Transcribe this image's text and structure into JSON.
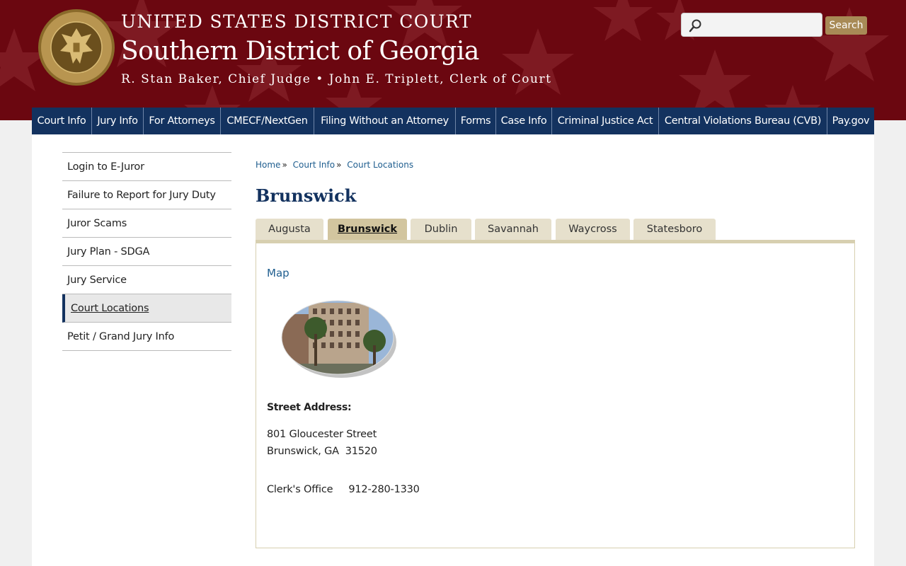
{
  "header": {
    "court_name": "UNITED STATES DISTRICT COURT",
    "district": "Southern District of Georgia",
    "officials": "R. Stan Baker, Chief Judge • John E. Triplett, Clerk of Court",
    "colors": {
      "banner": "#6b0710",
      "nav": "#13325f",
      "accent": "#a88a56"
    }
  },
  "search": {
    "placeholder": "",
    "value": "",
    "button_label": "Search",
    "icon": "search-icon"
  },
  "nav": {
    "items": [
      "Court Info",
      "Jury Info",
      "For Attorneys",
      "CMECF/NextGen",
      "Filing Without an Attorney",
      "Forms",
      "Case Info",
      "Criminal Justice Act",
      "Central Violations Bureau (CVB)",
      "Pay.gov"
    ]
  },
  "sidebar": {
    "items": [
      "Login to E-Juror",
      "Failure to Report for Jury Duty",
      "Juror Scams",
      "Jury Plan - SDGA",
      "Jury Service",
      "Court Locations",
      "Petit / Grand Jury Info"
    ],
    "active": "Court Locations"
  },
  "breadcrumb": {
    "items": [
      "Home",
      "Court Info",
      "Court Locations"
    ],
    "separator": "»"
  },
  "page": {
    "title": "Brunswick"
  },
  "tabs": {
    "items": [
      "Augusta",
      "Brunswick",
      "Dublin",
      "Savannah",
      "Waycross",
      "Statesboro"
    ],
    "active": "Brunswick"
  },
  "location": {
    "map_link": "Map",
    "address_label": "Street Address:",
    "address_line1": "801 Gloucester Street",
    "address_line2": "Brunswick, GA  31520",
    "clerk_line": "Clerk's Office     912-280-1330"
  }
}
